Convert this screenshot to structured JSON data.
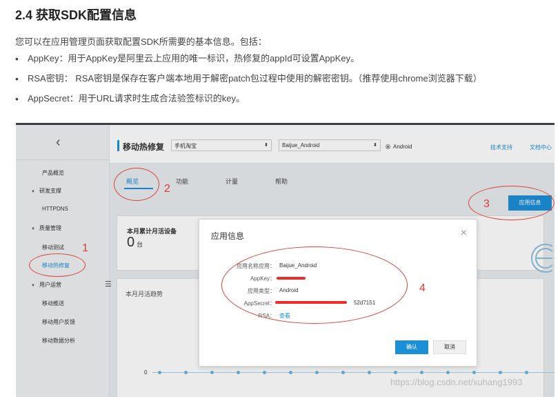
{
  "doc": {
    "title": "2.4 获取SDK配置信息",
    "intro": "您可以在应用管理页面获取配置SDK所需要的基本信息。包括：",
    "bullets": [
      "AppKey：用于AppKey是阿里云上应用的唯一标识，热修复的appId可设置AppKey。",
      "RSA密钥： RSA密钥是保存在客户端本地用于解密patch包过程中使用的解密密钥。（推荐使用chrome浏览器下载）",
      "AppSecret：用于URL请求时生成合法验签标识的key。"
    ]
  },
  "console": {
    "sidebar": {
      "back_icon": "chevron-left-icon",
      "items": [
        {
          "label": "产品概览",
          "type": "item"
        },
        {
          "label": "研发支撑",
          "type": "group"
        },
        {
          "label": "HTTPDNS",
          "type": "item"
        },
        {
          "label": "质量管理",
          "type": "group"
        },
        {
          "label": "移动测试",
          "type": "item"
        },
        {
          "label": "移动热修复",
          "type": "item",
          "active": true
        },
        {
          "label": "用户运营",
          "type": "group"
        },
        {
          "label": "移动推送",
          "type": "item"
        },
        {
          "label": "移动用户反馈",
          "type": "item"
        },
        {
          "label": "移动数据分析",
          "type": "item"
        }
      ]
    },
    "topbar": {
      "title": "移动热修复",
      "select_project": "手机淘宝",
      "select_app": "Baijue_Android",
      "platform": "Android",
      "link_support": "技术支持",
      "link_docs": "文档中心"
    },
    "tabs": [
      "概览",
      "功能",
      "计量",
      "帮助"
    ],
    "active_tab": 0,
    "app_info_button": "应用信息",
    "stats": {
      "monthly_devices_label": "本月累计月活设备",
      "monthly_devices_value": "0",
      "monthly_devices_unit": "台"
    },
    "trend_label": "本月月活趋势",
    "trend_axis_zero": "0",
    "modal": {
      "title": "应用信息",
      "rows": [
        {
          "label": "应用名称应用：",
          "value": "Baijue_Android"
        },
        {
          "label": "AppKey：",
          "value": ""
        },
        {
          "label": "应用类型：",
          "value": "Android"
        },
        {
          "label": "AppSecret：",
          "value": "52d7151"
        },
        {
          "label": "RSA：",
          "value": "查看"
        }
      ],
      "ok": "确认",
      "cancel": "取消"
    }
  },
  "annotations": [
    "1",
    "2",
    "3",
    "4"
  ],
  "watermark": "https://blog.csdn.net/xuhang1993",
  "colors": {
    "accent": "#1c8fd9",
    "annotation": "#e03a2e"
  }
}
